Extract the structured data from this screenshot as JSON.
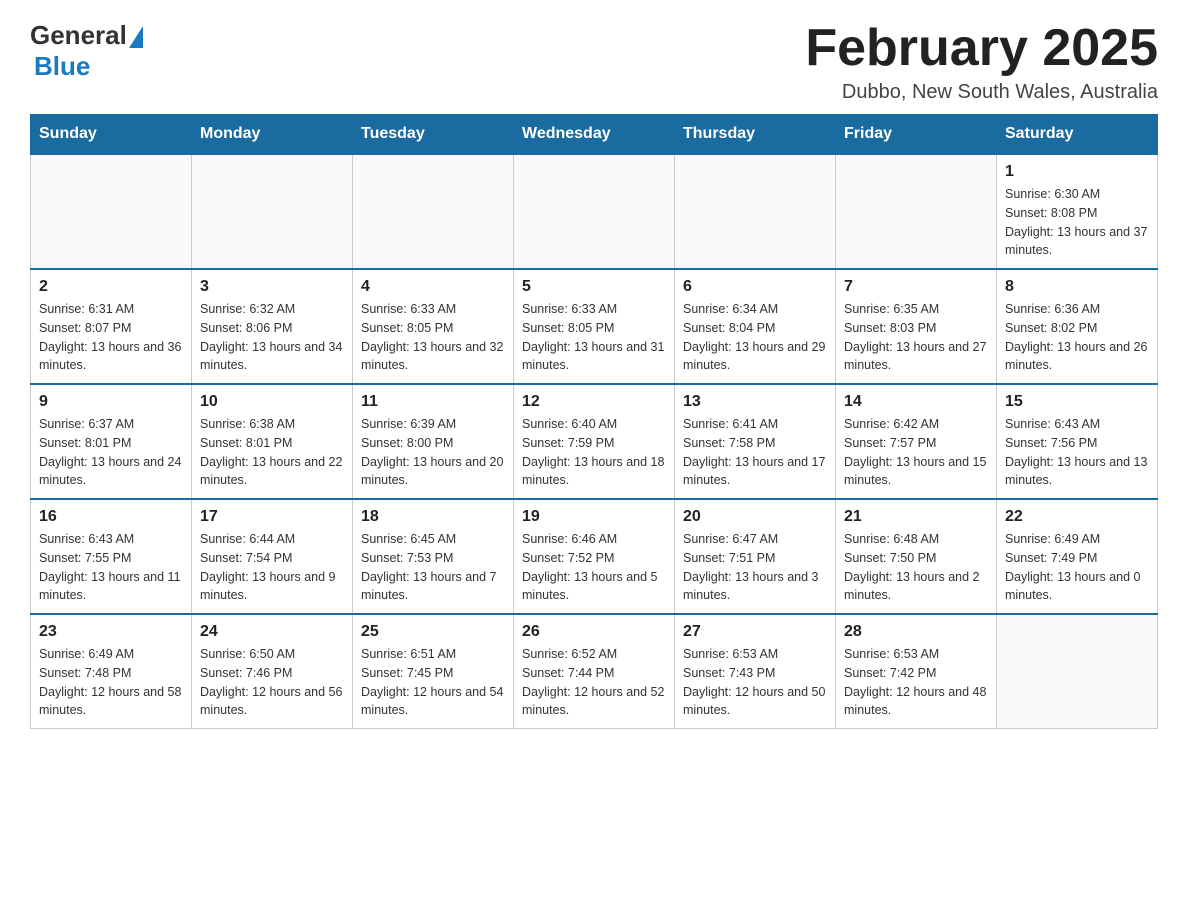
{
  "header": {
    "logo": {
      "general": "General",
      "blue": "Blue"
    },
    "title": "February 2025",
    "subtitle": "Dubbo, New South Wales, Australia"
  },
  "days_of_week": [
    "Sunday",
    "Monday",
    "Tuesday",
    "Wednesday",
    "Thursday",
    "Friday",
    "Saturday"
  ],
  "weeks": [
    [
      {
        "day": "",
        "info": ""
      },
      {
        "day": "",
        "info": ""
      },
      {
        "day": "",
        "info": ""
      },
      {
        "day": "",
        "info": ""
      },
      {
        "day": "",
        "info": ""
      },
      {
        "day": "",
        "info": ""
      },
      {
        "day": "1",
        "info": "Sunrise: 6:30 AM\nSunset: 8:08 PM\nDaylight: 13 hours and 37 minutes."
      }
    ],
    [
      {
        "day": "2",
        "info": "Sunrise: 6:31 AM\nSunset: 8:07 PM\nDaylight: 13 hours and 36 minutes."
      },
      {
        "day": "3",
        "info": "Sunrise: 6:32 AM\nSunset: 8:06 PM\nDaylight: 13 hours and 34 minutes."
      },
      {
        "day": "4",
        "info": "Sunrise: 6:33 AM\nSunset: 8:05 PM\nDaylight: 13 hours and 32 minutes."
      },
      {
        "day": "5",
        "info": "Sunrise: 6:33 AM\nSunset: 8:05 PM\nDaylight: 13 hours and 31 minutes."
      },
      {
        "day": "6",
        "info": "Sunrise: 6:34 AM\nSunset: 8:04 PM\nDaylight: 13 hours and 29 minutes."
      },
      {
        "day": "7",
        "info": "Sunrise: 6:35 AM\nSunset: 8:03 PM\nDaylight: 13 hours and 27 minutes."
      },
      {
        "day": "8",
        "info": "Sunrise: 6:36 AM\nSunset: 8:02 PM\nDaylight: 13 hours and 26 minutes."
      }
    ],
    [
      {
        "day": "9",
        "info": "Sunrise: 6:37 AM\nSunset: 8:01 PM\nDaylight: 13 hours and 24 minutes."
      },
      {
        "day": "10",
        "info": "Sunrise: 6:38 AM\nSunset: 8:01 PM\nDaylight: 13 hours and 22 minutes."
      },
      {
        "day": "11",
        "info": "Sunrise: 6:39 AM\nSunset: 8:00 PM\nDaylight: 13 hours and 20 minutes."
      },
      {
        "day": "12",
        "info": "Sunrise: 6:40 AM\nSunset: 7:59 PM\nDaylight: 13 hours and 18 minutes."
      },
      {
        "day": "13",
        "info": "Sunrise: 6:41 AM\nSunset: 7:58 PM\nDaylight: 13 hours and 17 minutes."
      },
      {
        "day": "14",
        "info": "Sunrise: 6:42 AM\nSunset: 7:57 PM\nDaylight: 13 hours and 15 minutes."
      },
      {
        "day": "15",
        "info": "Sunrise: 6:43 AM\nSunset: 7:56 PM\nDaylight: 13 hours and 13 minutes."
      }
    ],
    [
      {
        "day": "16",
        "info": "Sunrise: 6:43 AM\nSunset: 7:55 PM\nDaylight: 13 hours and 11 minutes."
      },
      {
        "day": "17",
        "info": "Sunrise: 6:44 AM\nSunset: 7:54 PM\nDaylight: 13 hours and 9 minutes."
      },
      {
        "day": "18",
        "info": "Sunrise: 6:45 AM\nSunset: 7:53 PM\nDaylight: 13 hours and 7 minutes."
      },
      {
        "day": "19",
        "info": "Sunrise: 6:46 AM\nSunset: 7:52 PM\nDaylight: 13 hours and 5 minutes."
      },
      {
        "day": "20",
        "info": "Sunrise: 6:47 AM\nSunset: 7:51 PM\nDaylight: 13 hours and 3 minutes."
      },
      {
        "day": "21",
        "info": "Sunrise: 6:48 AM\nSunset: 7:50 PM\nDaylight: 13 hours and 2 minutes."
      },
      {
        "day": "22",
        "info": "Sunrise: 6:49 AM\nSunset: 7:49 PM\nDaylight: 13 hours and 0 minutes."
      }
    ],
    [
      {
        "day": "23",
        "info": "Sunrise: 6:49 AM\nSunset: 7:48 PM\nDaylight: 12 hours and 58 minutes."
      },
      {
        "day": "24",
        "info": "Sunrise: 6:50 AM\nSunset: 7:46 PM\nDaylight: 12 hours and 56 minutes."
      },
      {
        "day": "25",
        "info": "Sunrise: 6:51 AM\nSunset: 7:45 PM\nDaylight: 12 hours and 54 minutes."
      },
      {
        "day": "26",
        "info": "Sunrise: 6:52 AM\nSunset: 7:44 PM\nDaylight: 12 hours and 52 minutes."
      },
      {
        "day": "27",
        "info": "Sunrise: 6:53 AM\nSunset: 7:43 PM\nDaylight: 12 hours and 50 minutes."
      },
      {
        "day": "28",
        "info": "Sunrise: 6:53 AM\nSunset: 7:42 PM\nDaylight: 12 hours and 48 minutes."
      },
      {
        "day": "",
        "info": ""
      }
    ]
  ]
}
